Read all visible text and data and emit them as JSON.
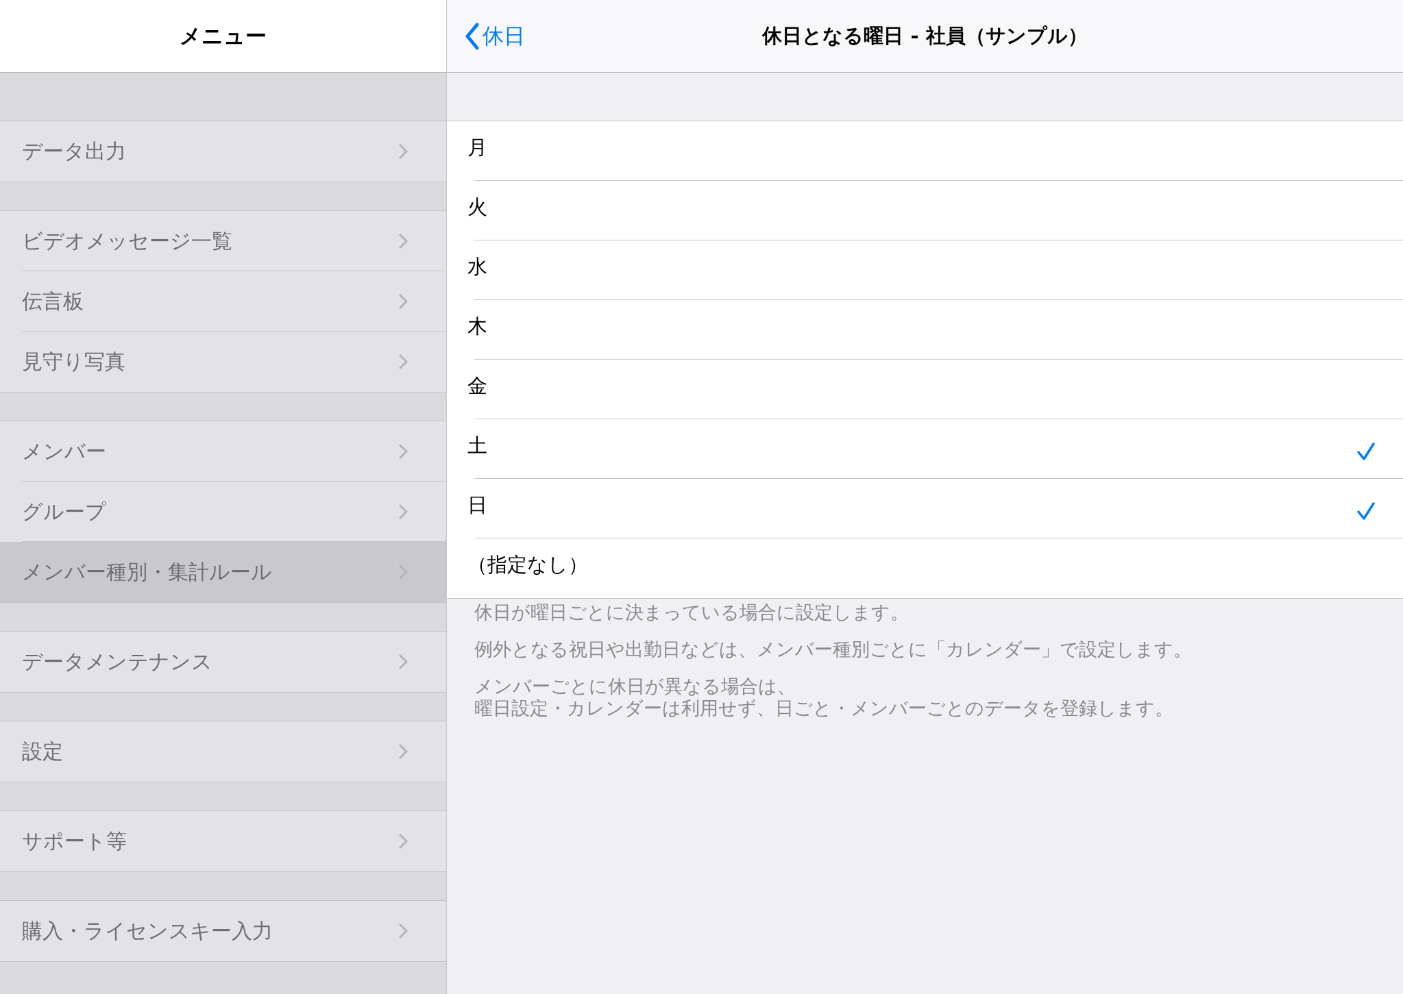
{
  "sidebar": {
    "title": "メニュー",
    "sections": [
      {
        "items": [
          {
            "label": "データ出力",
            "selected": false
          }
        ]
      },
      {
        "items": [
          {
            "label": "ビデオメッセージ一覧",
            "selected": false
          },
          {
            "label": "伝言板",
            "selected": false
          },
          {
            "label": "見守り写真",
            "selected": false
          }
        ]
      },
      {
        "items": [
          {
            "label": "メンバー",
            "selected": false
          },
          {
            "label": "グループ",
            "selected": false
          },
          {
            "label": "メンバー種別・集計ルール",
            "selected": true
          }
        ]
      },
      {
        "items": [
          {
            "label": "データメンテナンス",
            "selected": false
          }
        ]
      },
      {
        "items": [
          {
            "label": "設定",
            "selected": false
          }
        ]
      },
      {
        "items": [
          {
            "label": "サポート等",
            "selected": false
          }
        ]
      },
      {
        "items": [
          {
            "label": "購入・ライセンスキー入力",
            "selected": false
          }
        ]
      }
    ]
  },
  "detail": {
    "back_label": "休日",
    "title": "休日となる曜日 - 社員（サンプル）",
    "options": [
      {
        "label": "月",
        "checked": false
      },
      {
        "label": "火",
        "checked": false
      },
      {
        "label": "水",
        "checked": false
      },
      {
        "label": "木",
        "checked": false
      },
      {
        "label": "金",
        "checked": false
      },
      {
        "label": "土",
        "checked": true
      },
      {
        "label": "日",
        "checked": true
      },
      {
        "label": "（指定なし）",
        "checked": false
      }
    ],
    "footer_notes": [
      {
        "lines": [
          "休日が曜日ごとに決まっている場合に設定します。"
        ]
      },
      {
        "lines": [
          "例外となる祝日や出勤日などは、メンバー種別ごとに「カレンダー」で設定します。"
        ]
      },
      {
        "lines": [
          "メンバーごとに休日が異なる場合は、",
          "曜日設定・カレンダーは利用せず、日ごと・メンバーごとのデータを登録します。"
        ]
      }
    ]
  }
}
